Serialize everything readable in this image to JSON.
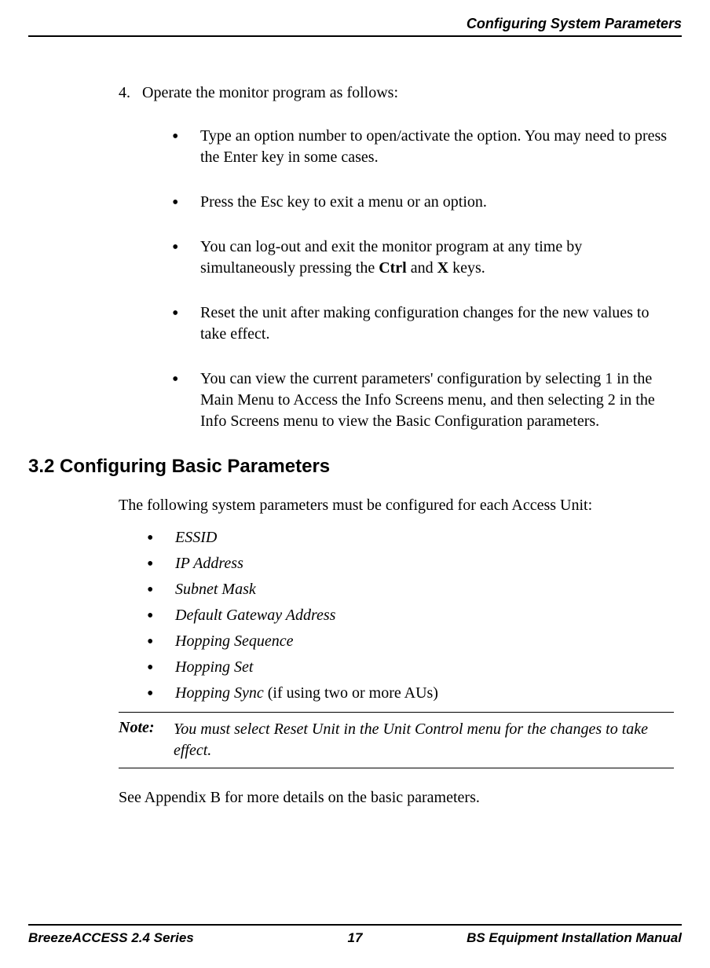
{
  "header": {
    "title": "Configuring System Parameters"
  },
  "step4": {
    "number": "4.",
    "text": "Operate the monitor program as follows:",
    "bullets": {
      "b1": "Type an option number to open/activate the option. You may need to press the Enter key in some cases.",
      "b2": "Press the Esc key to exit a menu or an option.",
      "b3_pre": "You can log-out and exit the monitor program at any time by simultaneously pressing the ",
      "b3_b1": "Ctrl",
      "b3_mid": " and ",
      "b3_b2": "X",
      "b3_post": " keys.",
      "b4": "Reset the unit after making configuration changes for the new values to take effect.",
      "b5": "You can view the current parameters' configuration by selecting 1 in the Main Menu to Access the Info Screens menu, and then selecting 2 in the Info Screens menu to view the Basic Configuration parameters."
    }
  },
  "section32": {
    "heading": "3.2  Configuring Basic Parameters",
    "intro": "The following system parameters must be configured for each Access Unit:",
    "params": {
      "p1": "ESSID",
      "p2": "IP Address",
      "p3": "Subnet Mask",
      "p4": "Default Gateway Address",
      "p5": "Hopping Sequence",
      "p6": "Hopping Set",
      "p7_italic": "Hopping Sync",
      "p7_rest": " (if using two or more AUs)"
    },
    "note": {
      "label": "Note:",
      "text": "You must select Reset Unit in the Unit Control menu for the changes to take effect."
    },
    "closing": "See Appendix B for more details on the basic parameters."
  },
  "footer": {
    "left": "BreezeACCESS 2.4 Series",
    "center": "17",
    "right": "BS Equipment Installation Manual"
  }
}
